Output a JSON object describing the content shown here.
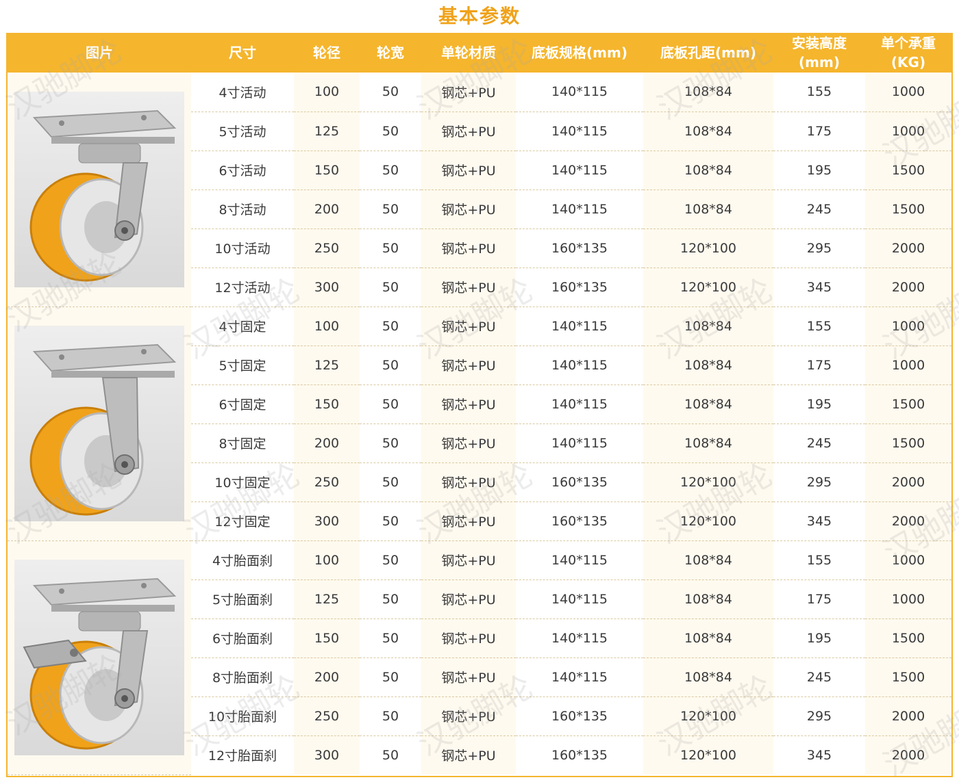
{
  "page": {
    "title": "基本参数",
    "watermark": "汉驰脚轮"
  },
  "colors": {
    "header_bg": "#f5b52d",
    "title": "#f0a21a",
    "shade": "#fffaef",
    "wheel": "#f0a21a"
  },
  "table": {
    "headers": {
      "image": "图片",
      "size": "尺寸",
      "diameter": "轮径",
      "width": "轮宽",
      "material": "单轮材质",
      "plate": "底板规格(mm)",
      "hole": "底板孔距(mm)",
      "height": "安装高度\n(mm)",
      "load": "单个承重\n(KG)"
    },
    "groups": [
      {
        "image_icon": "swivel-caster-icon",
        "rows": [
          {
            "size": "4寸活动",
            "diameter": "100",
            "width": "50",
            "material": "钢芯+PU",
            "plate": "140*115",
            "hole": "108*84",
            "height": "155",
            "load": "1000"
          },
          {
            "size": "5寸活动",
            "diameter": "125",
            "width": "50",
            "material": "钢芯+PU",
            "plate": "140*115",
            "hole": "108*84",
            "height": "175",
            "load": "1000"
          },
          {
            "size": "6寸活动",
            "diameter": "150",
            "width": "50",
            "material": "钢芯+PU",
            "plate": "140*115",
            "hole": "108*84",
            "height": "195",
            "load": "1500"
          },
          {
            "size": "8寸活动",
            "diameter": "200",
            "width": "50",
            "material": "钢芯+PU",
            "plate": "140*115",
            "hole": "108*84",
            "height": "245",
            "load": "1500"
          },
          {
            "size": "10寸活动",
            "diameter": "250",
            "width": "50",
            "material": "钢芯+PU",
            "plate": "160*135",
            "hole": "120*100",
            "height": "295",
            "load": "2000"
          },
          {
            "size": "12寸活动",
            "diameter": "300",
            "width": "50",
            "material": "钢芯+PU",
            "plate": "160*135",
            "hole": "120*100",
            "height": "345",
            "load": "2000"
          }
        ]
      },
      {
        "image_icon": "fixed-caster-icon",
        "rows": [
          {
            "size": "4寸固定",
            "diameter": "100",
            "width": "50",
            "material": "钢芯+PU",
            "plate": "140*115",
            "hole": "108*84",
            "height": "155",
            "load": "1000"
          },
          {
            "size": "5寸固定",
            "diameter": "125",
            "width": "50",
            "material": "钢芯+PU",
            "plate": "140*115",
            "hole": "108*84",
            "height": "175",
            "load": "1000"
          },
          {
            "size": "6寸固定",
            "diameter": "150",
            "width": "50",
            "material": "钢芯+PU",
            "plate": "140*115",
            "hole": "108*84",
            "height": "195",
            "load": "1500"
          },
          {
            "size": "8寸固定",
            "diameter": "200",
            "width": "50",
            "material": "钢芯+PU",
            "plate": "140*115",
            "hole": "108*84",
            "height": "245",
            "load": "1500"
          },
          {
            "size": "10寸固定",
            "diameter": "250",
            "width": "50",
            "material": "钢芯+PU",
            "plate": "160*135",
            "hole": "120*100",
            "height": "295",
            "load": "2000"
          },
          {
            "size": "12寸固定",
            "diameter": "300",
            "width": "50",
            "material": "钢芯+PU",
            "plate": "160*135",
            "hole": "120*100",
            "height": "345",
            "load": "2000"
          }
        ]
      },
      {
        "image_icon": "brake-caster-icon",
        "rows": [
          {
            "size": "4寸胎面刹",
            "diameter": "100",
            "width": "50",
            "material": "钢芯+PU",
            "plate": "140*115",
            "hole": "108*84",
            "height": "155",
            "load": "1000"
          },
          {
            "size": "5寸胎面刹",
            "diameter": "125",
            "width": "50",
            "material": "钢芯+PU",
            "plate": "140*115",
            "hole": "108*84",
            "height": "175",
            "load": "1000"
          },
          {
            "size": "6寸胎面刹",
            "diameter": "150",
            "width": "50",
            "material": "钢芯+PU",
            "plate": "140*115",
            "hole": "108*84",
            "height": "195",
            "load": "1500"
          },
          {
            "size": "8寸胎面刹",
            "diameter": "200",
            "width": "50",
            "material": "钢芯+PU",
            "plate": "140*115",
            "hole": "108*84",
            "height": "245",
            "load": "1500"
          },
          {
            "size": "10寸胎面刹",
            "diameter": "250",
            "width": "50",
            "material": "钢芯+PU",
            "plate": "160*135",
            "hole": "120*100",
            "height": "295",
            "load": "2000"
          },
          {
            "size": "12寸胎面刹",
            "diameter": "300",
            "width": "50",
            "material": "钢芯+PU",
            "plate": "160*135",
            "hole": "120*100",
            "height": "345",
            "load": "2000"
          }
        ]
      }
    ]
  }
}
